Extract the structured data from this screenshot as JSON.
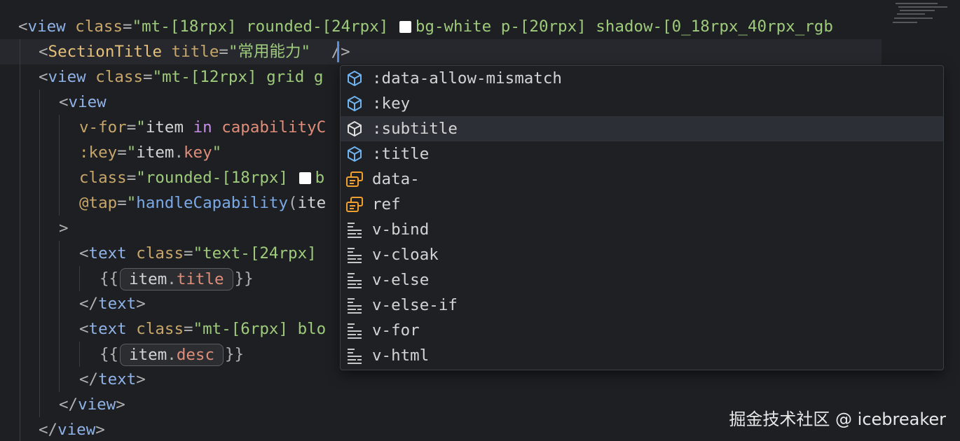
{
  "colors": {
    "background": "#1e1f22",
    "tag": "#8fb3e8",
    "component": "#e5c07b",
    "attribute": "#c7a66a",
    "string": "#9ecb7b",
    "keyword": "#c58ee8",
    "property": "#e08d7a",
    "function": "#7aa9e8",
    "cursor": "#5a8ed8",
    "field_icon": "#6fb4f0",
    "snippet_icon": "#f0a030"
  },
  "code": {
    "l1": {
      "open": "<",
      "tag": "view",
      "attr": "class",
      "eq": "=",
      "val": "\"mt-[18rpx] rounded-[24rpx] ",
      "val2": "bg-white p-[20rpx] shadow-[0_18rpx_40rpx_rgb"
    },
    "l2": {
      "open": "<",
      "tag": "SectionTitle",
      "attr": "title",
      "eq": "=",
      "val": "\"常用能力\"",
      "close": " />"
    },
    "l3": {
      "open": "<",
      "tag": "view",
      "attr": "class",
      "eq": "=",
      "val": "\"mt-[12rpx] grid g"
    },
    "l4": {
      "open": "<",
      "tag": "view"
    },
    "l5": {
      "attr": "v-for",
      "eq": "=",
      "q": "\"",
      "var": "item",
      "kw": "in",
      "src": "capabilityC"
    },
    "l6": {
      "attr": ":key",
      "eq": "=",
      "q": "\"",
      "obj": "item",
      "dot": ".",
      "prop": "key",
      "q2": "\""
    },
    "l7": {
      "attr": "class",
      "eq": "=",
      "val": "\"rounded-[18rpx] ",
      "val2": "b"
    },
    "l8": {
      "attr": "@tap",
      "eq": "=",
      "q": "\"",
      "fn": "handleCapability",
      "paren": "(",
      "arg": "ite"
    },
    "l9": {
      "text": ">"
    },
    "l10": {
      "open": "<",
      "tag": "text",
      "attr": "class",
      "eq": "=",
      "val": "\"text-[24rpx] "
    },
    "l11": {
      "lb": "{{",
      "obj": "item",
      "dot": ".",
      "prop": "title",
      "rb": "}}"
    },
    "l12": {
      "open": "</",
      "tag": "text",
      "close": ">"
    },
    "l13": {
      "open": "<",
      "tag": "text",
      "attr": "class",
      "eq": "=",
      "val": "\"mt-[6rpx] blo"
    },
    "l14": {
      "lb": "{{",
      "obj": "item",
      "dot": ".",
      "prop": "desc",
      "rb": "}}"
    },
    "l15": {
      "open": "</",
      "tag": "text",
      "close": ">"
    },
    "l16": {
      "open": "</",
      "tag": "view",
      "close": ">"
    },
    "l17": {
      "open": "</",
      "tag": "view",
      "close": ">"
    }
  },
  "suggestions": [
    {
      "label": ":data-allow-mismatch",
      "icon": "field-icon"
    },
    {
      "label": ":key",
      "icon": "field-icon"
    },
    {
      "label": ":subtitle",
      "icon": "field-icon",
      "selected": true
    },
    {
      "label": ":title",
      "icon": "field-icon"
    },
    {
      "label": "data-",
      "icon": "snippet-icon"
    },
    {
      "label": "ref",
      "icon": "snippet-icon"
    },
    {
      "label": "v-bind",
      "icon": "keyword-icon"
    },
    {
      "label": "v-cloak",
      "icon": "keyword-icon"
    },
    {
      "label": "v-else",
      "icon": "keyword-icon"
    },
    {
      "label": "v-else-if",
      "icon": "keyword-icon"
    },
    {
      "label": "v-for",
      "icon": "keyword-icon"
    },
    {
      "label": "v-html",
      "icon": "keyword-icon"
    }
  ],
  "watermark": "掘金技术社区 @ icebreaker"
}
